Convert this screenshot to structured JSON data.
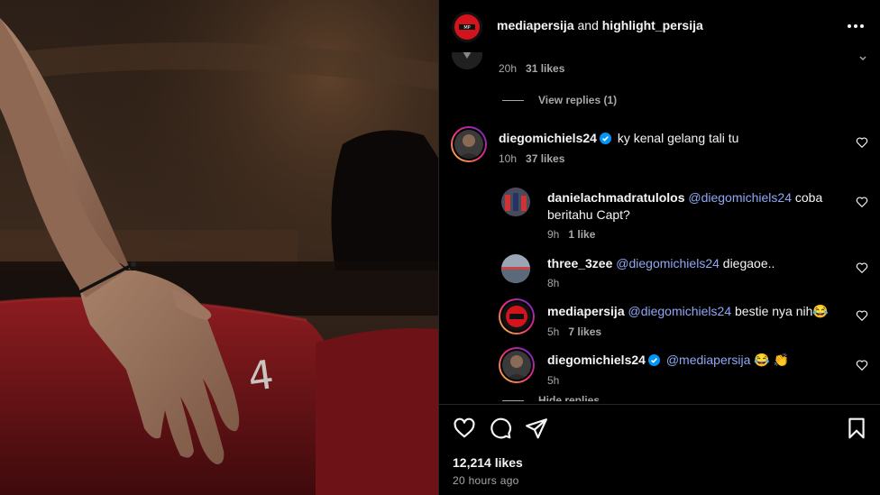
{
  "post": {
    "author": "mediapersija",
    "and_text": "and",
    "coauthor": "highlight_persija",
    "likes": "12,214 likes",
    "time_ago": "20 hours ago"
  },
  "photo": {
    "seat_number": "4"
  },
  "comments": [
    {
      "id": "c0",
      "time": "20h",
      "likes": "31 likes",
      "view_replies": "View replies (1)"
    },
    {
      "id": "c1",
      "username": "diegomichiels24",
      "verified": true,
      "text": "ky kenal gelang tali tu",
      "time": "10h",
      "likes": "37 likes"
    }
  ],
  "replies": [
    {
      "username": "danielachmadratulolos",
      "mention": "@diegomichiels24",
      "text_line1": " coba",
      "text_line2": "beritahu Capt?",
      "time": "9h",
      "likes": "1 like"
    },
    {
      "username": "three_3zee",
      "mention": "@diegomichiels24",
      "text": " diegaoe..",
      "time": "8h",
      "likes": ""
    },
    {
      "username": "mediapersija",
      "mention": "@diegomichiels24",
      "text": " bestie nya nih😂",
      "time": "5h",
      "likes": "7 likes"
    },
    {
      "username": "diegomichiels24",
      "verified": true,
      "mention": "@mediapersija",
      "text": " 😂 👏",
      "time": "5h",
      "likes": ""
    }
  ],
  "hide_replies": "Hide replies",
  "icons": [
    "more-options-icon",
    "heart-icon",
    "comment-icon",
    "share-icon",
    "bookmark-icon",
    "verified-icon"
  ],
  "colors": {
    "background": "#000000",
    "text": "#f5f5f5",
    "secondary": "#a8a8a8",
    "mention": "#8fa8f5",
    "verified": "#0095f6",
    "seat_red": "#7a1518"
  }
}
